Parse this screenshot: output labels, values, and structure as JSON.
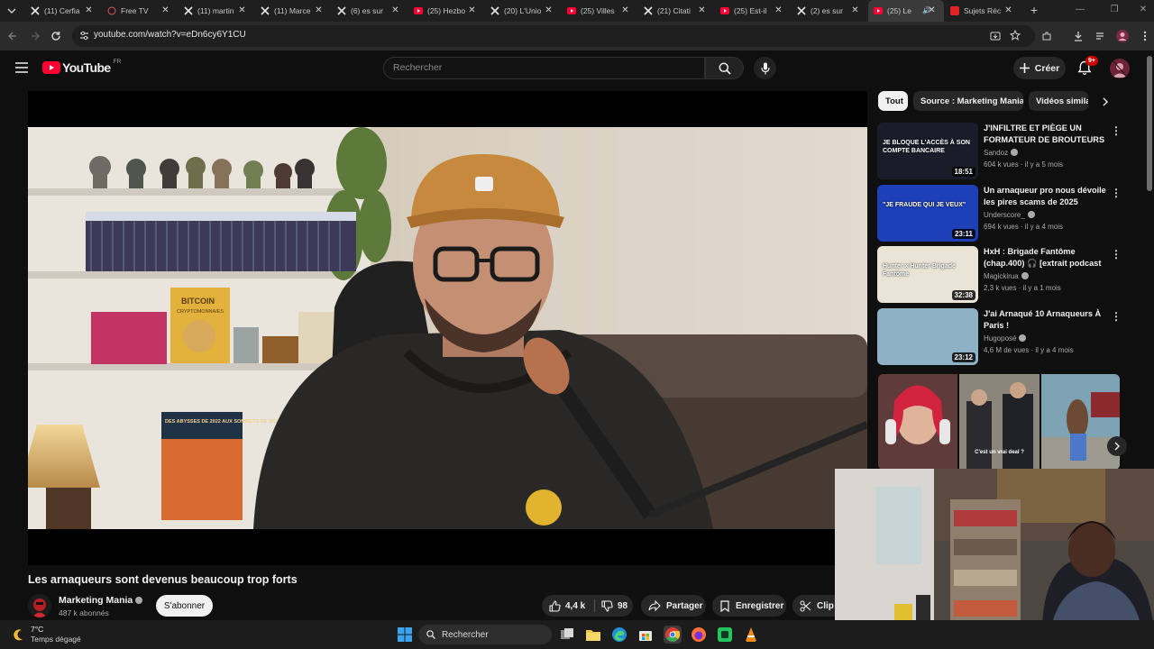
{
  "browser": {
    "tabs": [
      {
        "title": "(11) Cerfia",
        "icon": "x-logo-icon"
      },
      {
        "title": "Free TV",
        "icon": "globe-icon"
      },
      {
        "title": "(11) martin",
        "icon": "x-logo-icon"
      },
      {
        "title": "(11) Marce",
        "icon": "x-logo-icon"
      },
      {
        "title": "(6) es sur",
        "icon": "x-logo-icon"
      },
      {
        "title": "(25) Hezbo",
        "icon": "youtube-icon"
      },
      {
        "title": "(20) L'Unio",
        "icon": "x-logo-icon"
      },
      {
        "title": "(25) Villes",
        "icon": "youtube-icon"
      },
      {
        "title": "(21) Citati",
        "icon": "x-logo-icon"
      },
      {
        "title": "(25) Est-il",
        "icon": "youtube-icon"
      },
      {
        "title": "(2) es sur",
        "icon": "x-logo-icon"
      },
      {
        "title": "(25) Le",
        "icon": "youtube-icon",
        "active": true
      },
      {
        "title": "Sujets Réc",
        "icon": "red-square-icon"
      }
    ],
    "new_tab": "+",
    "url": "youtube.com/watch?v=eDn6cy6Y1CU"
  },
  "header": {
    "logo_text": "YouTube",
    "logo_region": "FR",
    "search_placeholder": "Rechercher",
    "create_label": "Créer",
    "notification_badge": "9+"
  },
  "video": {
    "title": "Les arnaqueurs sont devenus beaucoup trop forts",
    "channel": "Marketing Mania",
    "subscribers": "487 k abonnés",
    "subscribe_label": "S'abonner",
    "likes": "4,4 k",
    "dislikes": "98",
    "share_label": "Partager",
    "save_label": "Enregistrer",
    "clip_label": "Clip",
    "book_title": "BITCOIN",
    "book_subtitle": "CRYPTOMONNAIES",
    "book2_title": "DES ABYSSES DE 2022 AUX SOMMETS DE 2024"
  },
  "sidebar": {
    "chips": [
      "Tout",
      "Source : Marketing Mania",
      "Vidéos similaires"
    ],
    "recommendations": [
      {
        "title": "J'INFILTRE ET PIÈGE UN FORMATEUR DE BROUTEURS",
        "channel": "Sandoz",
        "meta": "604 k vues · il y a 5 mois",
        "duration": "18:51",
        "thumb_text": "JE BLOQUE L'ACCÈS À SON COMPTE BANCAIRE",
        "thumb_color": "#1a1c2a"
      },
      {
        "title": "Un arnaqueur pro nous dévoile les pires scams de 2025",
        "channel": "Underscore_",
        "meta": "694 k vues · il y a 4 mois",
        "duration": "23:11",
        "thumb_text": "\"JE FRAUDE QUI JE VEUX\"",
        "thumb_color": "#1d3fb8"
      },
      {
        "title": "HxH : Brigade Fantôme (chap.400) 🎧 [extrait podcast ...",
        "channel": "Magickirua",
        "meta": "2,3 k vues · il y a 1 mois",
        "duration": "32:38",
        "thumb_text": "Hunter x Hunter Brigade Fantôme",
        "thumb_color": "#e9e4d6"
      },
      {
        "title": "J'ai Arnaqué 10 Arnaqueurs À Paris !",
        "channel": "Hugoposé",
        "meta": "4,6 M de vues · il y a 4 mois",
        "duration": "23:12",
        "thumb_text": "",
        "thumb_color": "#8fb1c6"
      }
    ],
    "shorts_caption": "C'est un vrai deal ?"
  },
  "taskbar": {
    "weather_temp": "7°C",
    "weather_desc": "Temps dégagé",
    "search_label": "Rechercher"
  }
}
